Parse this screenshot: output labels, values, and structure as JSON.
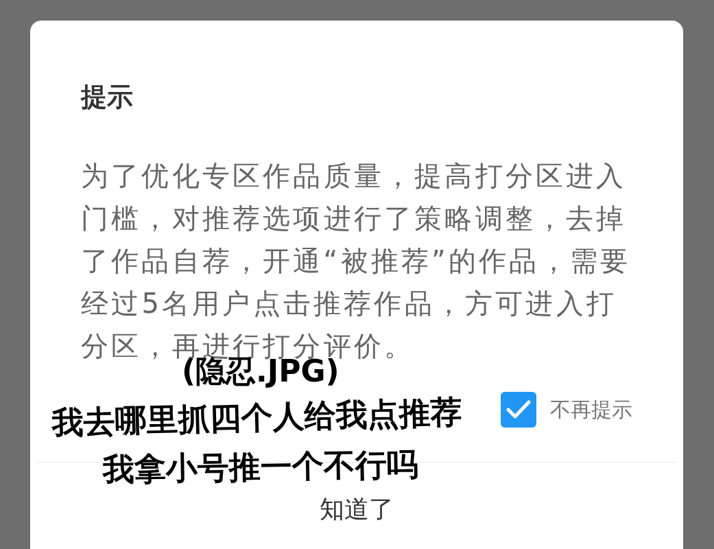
{
  "dialog": {
    "title": "提示",
    "message": "为了优化专区作品质量，提高打分区进入门槛，对推荐选项进行了策略调整，去掉了作品自荐，开通“被推荐”的作品，需要经过5名用户点击推荐作品，方可进入打分区，再进行打分评价。",
    "checkbox": {
      "label": "不再提示",
      "checked": true
    },
    "button": "知道了"
  },
  "annotations": [
    "(隐忍.JPG)",
    "我去哪里抓四个人给我点推荐",
    "我拿小号推一个不行吗"
  ]
}
